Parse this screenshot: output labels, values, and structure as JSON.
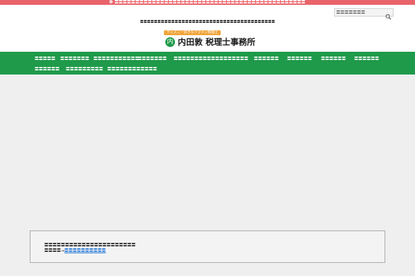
{
  "notice_bar": {
    "icon": "info-circle-icon",
    "text": "〓〓〓〓〓〓〓〓〓〓〓〓〓〓〓〓〓〓〓〓〓〓〓〓〓〓〓〓〓〓〓〓〓〓〓〓〓〓〓〓〓〓〓〓〓〓",
    "color": "#e8646a"
  },
  "header": {
    "search_placeholder": "〓〓〓〓〓〓〓",
    "search_icon": "magnifier-icon",
    "tagline": "〓〓〓〓〓〓〓〓〓〓〓〓〓〓〓〓〓〓〓〓〓〓〓〓〓〓〓〓〓〓〓〓〓〓〓〓〓〓〓",
    "logo_badge": "ディズニー好きなイクメン税理士",
    "logo_mark": "内",
    "logo_name": "内田敦 税理士事務所"
  },
  "nav": {
    "color": "#1f9a4a",
    "items": [
      "〓〓〓〓〓",
      "〓〓〓〓〓〓〓",
      "〓〓〓〓〓〓〓〓〓〓〓",
      "〓〓〓〓〓〓〓",
      "〓〓〓〓〓〓〓〓〓〓",
      "〓〓〓〓〓〓〓〓",
      "〓〓〓〓〓〓",
      "〓〓〓〓〓〓",
      "〓〓〓〓〓〓",
      "〓〓〓〓〓〓",
      "〓〓〓〓〓〓",
      "〓〓〓〓〓〓〓〓〓",
      "〓〓〓〓〓〓〓〓〓〓〓〓"
    ]
  },
  "notice_box": {
    "line1": "〓〓〓〓〓〓〓〓〓〓〓〓〓〓〓〓〓〓〓〓〓〓",
    "line2_prefix": "〓〓〓〓→",
    "line2_link": "〓〓〓〓〓〓〓〓〓〓",
    "link_color": "#1a6fd6"
  }
}
